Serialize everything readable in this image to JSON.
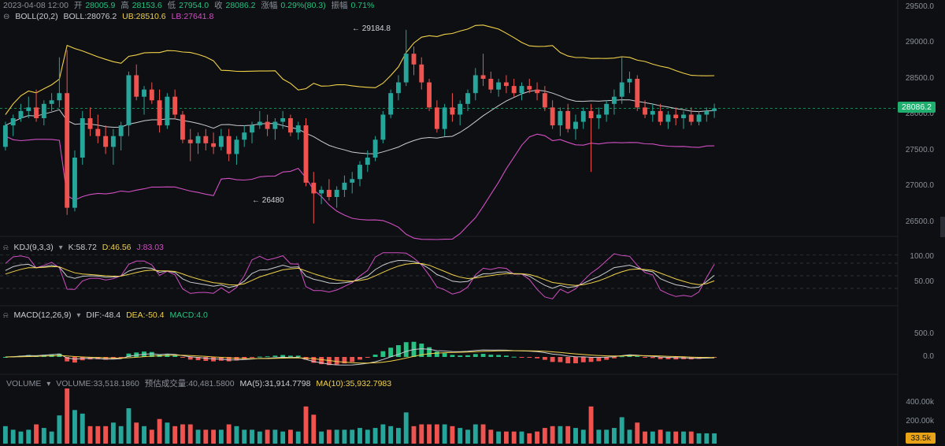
{
  "main": {
    "info_line": {
      "datetime": "2023-04-08 12:00",
      "open_label": "开",
      "open": "28005.9",
      "high_label": "高",
      "high": "28153.6",
      "low_label": "低",
      "low": "27954.0",
      "close_label": "收",
      "close": "28086.2",
      "change_label": "涨幅",
      "change": "0.29%(80.3)",
      "amplitude_label": "振幅",
      "amplitude": "0.71%"
    },
    "boll": {
      "name": "BOLL(20,2)",
      "value": "BOLL:28076.2",
      "ub": "UB:28510.6",
      "lb": "LB:27641.8"
    },
    "price_ticks": [
      "29500.0",
      "29000.0",
      "28500.0",
      "28000.0",
      "27500.0",
      "27000.0",
      "26500.0"
    ],
    "current_price": "28086.2",
    "high_marker": "29184.8",
    "low_marker": "26480"
  },
  "kdj": {
    "name": "KDJ(9,3,3)",
    "k": "K:58.72",
    "d": "D:46.56",
    "j": "J:83.03",
    "ticks": [
      "100.00",
      "50.00"
    ]
  },
  "macd": {
    "name": "MACD(12,26,9)",
    "dif": "DIF:-48.4",
    "dea": "DEA:-50.4",
    "macd": "MACD:4.0",
    "ticks": [
      "500.0",
      "0.0"
    ]
  },
  "volume": {
    "name": "VOLUME",
    "value": "VOLUME:33,518.1860",
    "est_label": "预估成交量:40,481.5800",
    "ma5": "MA(5):31,914.7798",
    "ma10": "MA(10):35,932.7983",
    "ticks": [
      "400.00k",
      "200.00k"
    ],
    "current_tag": "33.5k"
  },
  "colors": {
    "up": "#26a69a",
    "down": "#ef5350",
    "boll_mid": "#c9ccd1",
    "boll_ub": "#f0d14a",
    "boll_lb": "#d04fc3",
    "bg": "#0e0f12"
  },
  "chart_data": {
    "type": "candlestick",
    "price_range": [
      26300,
      29600
    ],
    "candles": [
      [
        27550,
        27900,
        27500,
        27850
      ],
      [
        27850,
        28000,
        27700,
        27950
      ],
      [
        27950,
        28150,
        27900,
        28050
      ],
      [
        28050,
        28250,
        27950,
        28100
      ],
      [
        28100,
        28350,
        27900,
        27950
      ],
      [
        27950,
        28200,
        27850,
        28150
      ],
      [
        28150,
        28300,
        28050,
        28200
      ],
      [
        28200,
        28800,
        28100,
        28300
      ],
      [
        28300,
        28900,
        26600,
        26700
      ],
      [
        26700,
        27500,
        26650,
        27400
      ],
      [
        27400,
        28050,
        27300,
        27950
      ],
      [
        27950,
        28100,
        27700,
        27800
      ],
      [
        27800,
        28000,
        27600,
        27700
      ],
      [
        27700,
        27850,
        27450,
        27550
      ],
      [
        27550,
        27800,
        27300,
        27700
      ],
      [
        27700,
        27900,
        27500,
        27850
      ],
      [
        27850,
        28600,
        27700,
        28550
      ],
      [
        28550,
        28700,
        28200,
        28250
      ],
      [
        28250,
        28400,
        28000,
        28350
      ],
      [
        28350,
        28450,
        28150,
        28200
      ],
      [
        28200,
        28350,
        27750,
        27850
      ],
      [
        27850,
        28300,
        27800,
        28250
      ],
      [
        28250,
        28350,
        27950,
        28000
      ],
      [
        28000,
        28050,
        27600,
        27650
      ],
      [
        27650,
        27800,
        27350,
        27600
      ],
      [
        27600,
        27750,
        27450,
        27700
      ],
      [
        27700,
        27800,
        27500,
        27600
      ],
      [
        27600,
        27750,
        27450,
        27550
      ],
      [
        27550,
        27800,
        27500,
        27700
      ],
      [
        27700,
        27800,
        27350,
        27450
      ],
      [
        27450,
        27700,
        27300,
        27650
      ],
      [
        27650,
        27850,
        27550,
        27750
      ],
      [
        27750,
        27900,
        27600,
        27850
      ],
      [
        27850,
        28050,
        27800,
        27900
      ],
      [
        27900,
        28000,
        27700,
        27800
      ],
      [
        27800,
        27950,
        27650,
        27900
      ],
      [
        27900,
        28050,
        27800,
        27950
      ],
      [
        27950,
        28000,
        27700,
        27750
      ],
      [
        27750,
        27900,
        27650,
        27850
      ],
      [
        27850,
        27950,
        27000,
        27050
      ],
      [
        27050,
        27200,
        26480,
        26900
      ],
      [
        26900,
        27000,
        26750,
        26950
      ],
      [
        26950,
        27100,
        26800,
        26850
      ],
      [
        26850,
        27000,
        26700,
        26950
      ],
      [
        26950,
        27150,
        26850,
        27050
      ],
      [
        27050,
        27200,
        26900,
        27100
      ],
      [
        27100,
        27350,
        27000,
        27300
      ],
      [
        27300,
        27500,
        27200,
        27400
      ],
      [
        27400,
        27700,
        27350,
        27650
      ],
      [
        27650,
        28050,
        27600,
        28000
      ],
      [
        28000,
        28350,
        27950,
        28300
      ],
      [
        28300,
        28550,
        28200,
        28450
      ],
      [
        28450,
        29184,
        28400,
        28850
      ],
      [
        28850,
        28950,
        28550,
        28700
      ],
      [
        28700,
        28800,
        28350,
        28450
      ],
      [
        28450,
        28500,
        28050,
        28100
      ],
      [
        28100,
        28200,
        27750,
        27800
      ],
      [
        27800,
        28150,
        27700,
        28100
      ],
      [
        28100,
        28300,
        27900,
        28000
      ],
      [
        28000,
        28200,
        27850,
        28150
      ],
      [
        28150,
        28350,
        28050,
        28300
      ],
      [
        28300,
        28650,
        28200,
        28550
      ],
      [
        28550,
        28850,
        28400,
        28500
      ],
      [
        28500,
        28600,
        28300,
        28350
      ],
      [
        28350,
        28500,
        28250,
        28450
      ],
      [
        28450,
        28550,
        28300,
        28400
      ],
      [
        28400,
        28500,
        28250,
        28300
      ],
      [
        28300,
        28450,
        28200,
        28400
      ],
      [
        28400,
        28500,
        28300,
        28350
      ],
      [
        28350,
        28450,
        28200,
        28300
      ],
      [
        28300,
        28400,
        28050,
        28100
      ],
      [
        28100,
        28200,
        27800,
        27850
      ],
      [
        27850,
        28100,
        27700,
        28050
      ],
      [
        28050,
        28150,
        27750,
        27800
      ],
      [
        27800,
        28000,
        27650,
        27900
      ],
      [
        27900,
        28100,
        27800,
        28050
      ],
      [
        28050,
        28150,
        27200,
        27950
      ],
      [
        27950,
        28100,
        27800,
        28000
      ],
      [
        28000,
        28200,
        27900,
        28150
      ],
      [
        28150,
        28350,
        28000,
        28250
      ],
      [
        28250,
        28800,
        28150,
        28450
      ],
      [
        28450,
        28600,
        28300,
        28500
      ],
      [
        28500,
        28550,
        28050,
        28100
      ],
      [
        28100,
        28200,
        27950,
        28000
      ],
      [
        28000,
        28150,
        27900,
        28050
      ],
      [
        28050,
        28150,
        27850,
        27900
      ],
      [
        27900,
        28050,
        27800,
        28000
      ],
      [
        28000,
        28100,
        27850,
        27950
      ],
      [
        27950,
        28050,
        27800,
        28000
      ],
      [
        28000,
        28100,
        27850,
        27900
      ],
      [
        27900,
        28050,
        27850,
        28000
      ],
      [
        28000,
        28100,
        27900,
        28050
      ],
      [
        28050,
        28153,
        27954,
        28086
      ]
    ]
  }
}
